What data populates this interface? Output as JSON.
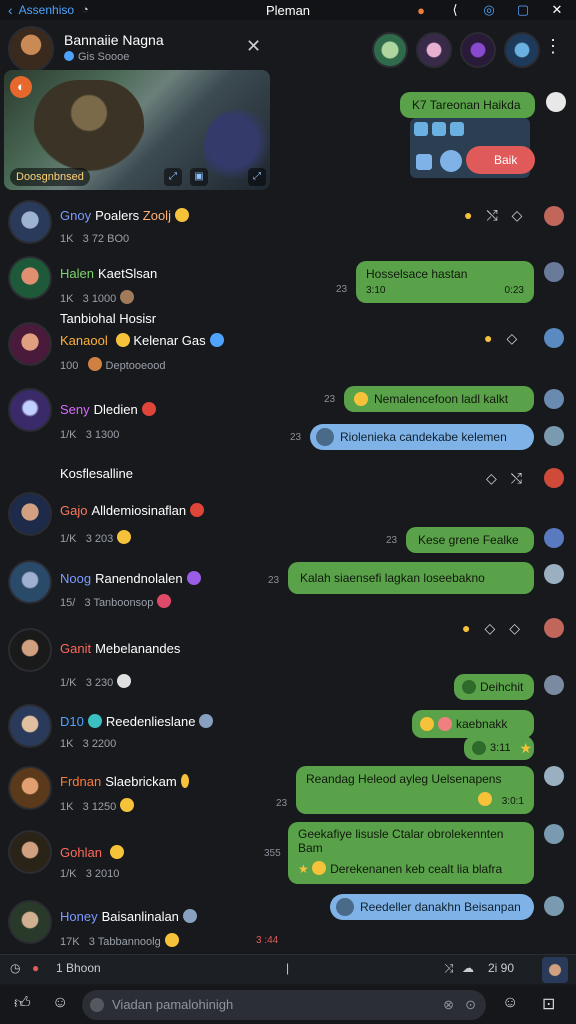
{
  "status": {
    "back": "‹",
    "carrier": "Assenhiso",
    "title": "Pleman",
    "icons": [
      "face-icon",
      "share-icon",
      "target-icon",
      "note-icon",
      "close-icon"
    ]
  },
  "header": {
    "name": "Bannaiie Nagna",
    "sub": "Gis Soooe",
    "close": "✕",
    "more": "⋮"
  },
  "media": {
    "caption": "Doosgnbnsed"
  },
  "right_card": {
    "green_text": "K7 Tareonan Haikda",
    "red_text": "Baik"
  },
  "rows": [
    {
      "tag": "Gnoy",
      "name": "Poalers",
      "extra": "Zoolj",
      "meta1": "1K",
      "meta2": "3  72 BO0"
    },
    {
      "tag": "Halen",
      "name": "KaetSlsan",
      "meta1": "1K",
      "meta2": "3  1000",
      "bubble": "Hosselsace hastan",
      "ts_left": "23",
      "ts_sub": "3:10",
      "ts_right": "0:23"
    },
    {
      "title": "Tanbiohal Hosisr",
      "tag": "Kanaool",
      "name": "Kelenar Gas",
      "meta1": "100",
      "meta2": "Deptooeood"
    },
    {
      "tag": "Seny",
      "name": "Dledien",
      "meta1": "1/K",
      "meta2": "3  1300",
      "bubble": "Nemalencefoon ladl kalkt",
      "bubble2": "Riolenieka candekabe kelemen",
      "ts1": "23",
      "ts2": "23"
    },
    {
      "title": "Kosflesalline"
    },
    {
      "tag": "Gajo",
      "name": "Alldemiosinaflan",
      "meta1": "1/K",
      "meta2": "3  203",
      "bubble": "Kese grene Fealke",
      "ts": "23"
    },
    {
      "tag": "Noog",
      "name": "Ranendnolalen",
      "meta1": "15/",
      "meta2": "3  Tanboonsop",
      "bubble": "Kalah siaensefi lagkan loseebakno",
      "ts": "23"
    },
    {
      "tag": "Ganit",
      "name": "Mebelanandes",
      "meta1": "1/K",
      "meta2": "3  230",
      "bubble": "Deihchit"
    },
    {
      "tag": "D10",
      "name": "Reedenlieslane",
      "meta1": "1K",
      "meta2": "3  2200",
      "bubble": "kaebnakk",
      "bubble_b": "3:11"
    },
    {
      "tag": "Frdnan",
      "name": "Slaebrickam",
      "meta1": "1K",
      "meta2": "3  1250",
      "bubble": "Reandag Heleod ayleg Uelsenapens",
      "bubble_sub": "3:0:1",
      "ts": "23"
    },
    {
      "tag": "Gohlan",
      "name": "",
      "meta1": "1/K",
      "meta2": "3  2010",
      "bubble": "Geekafiye lisusle Ctalar obrolekennten",
      "bubble_l2": "Bam",
      "bubble_l3": "Derekenanen keb cealt lia blafra",
      "ts": "355"
    },
    {
      "tag": "Honey",
      "name": "Baisanlinalan",
      "meta1": "17K",
      "meta2": "3  Tabbannoolg",
      "bubble": "Reedeller danakhn Beisanpan",
      "ts": "3 :44"
    }
  ],
  "composer": {
    "count": "1 Bhoon",
    "sep": "|",
    "stat": "2i 90",
    "placeholder": "Viadan pamalohinigh"
  },
  "colors": {
    "green": "#5aa24a",
    "blue": "#7fb3e8",
    "red": "#e05a5a",
    "accent": "#4fa3ff"
  }
}
